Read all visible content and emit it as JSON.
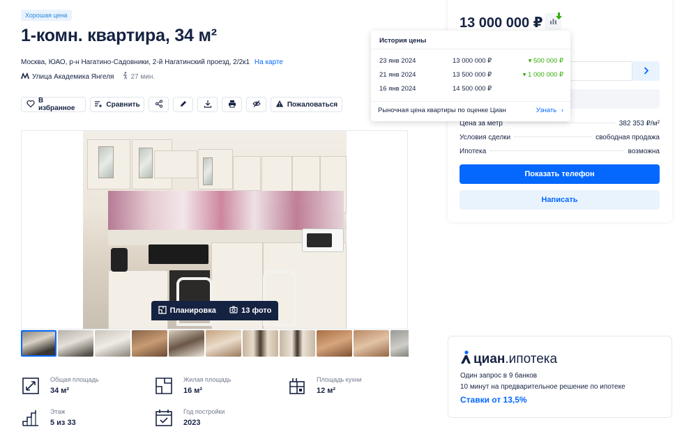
{
  "badge": "Хорошая цена",
  "title": "1-комн. квартира, 34 м²",
  "address": {
    "text": "Москва, ЮАО, р-н Нагатино-Садовники, 2-й Нагатинский проезд, 2/2к1",
    "map_link": "На карте"
  },
  "metro": {
    "icon": "metro-icon",
    "station": "Улица Академика Янгеля",
    "walk": "27 мин."
  },
  "actions": {
    "favorite": "В избранное",
    "compare": "Сравнить",
    "report": "Пожаловаться"
  },
  "gallery": {
    "layout_label": "Планировка",
    "photos_label": "13 фото"
  },
  "features": [
    {
      "icon": "total-area-icon",
      "label": "Общая площадь",
      "value": "34 м²"
    },
    {
      "icon": "living-area-icon",
      "label": "Жилая площадь",
      "value": "16 м²"
    },
    {
      "icon": "kitchen-area-icon",
      "label": "Площадь кухни",
      "value": "12 м²"
    },
    {
      "icon": "floor-icon",
      "label": "Этаж",
      "value": "5 из 33"
    },
    {
      "icon": "build-year-icon",
      "label": "Год постройки",
      "value": "2023"
    }
  ],
  "price_card": {
    "price": "13 000 000 ₽",
    "details": [
      {
        "key": "Цена за метр",
        "value": "382 353 ₽/м²"
      },
      {
        "key": "Условия сделки",
        "value": "свободная продажа"
      },
      {
        "key": "Ипотека",
        "value": "возможна"
      }
    ],
    "show_phone": "Показать телефон",
    "write": "Написать"
  },
  "price_history": {
    "title": "История цены",
    "rows": [
      {
        "date": "23 янв 2024",
        "price": "13 000 000 ₽",
        "change": "▾ 500 000 ₽"
      },
      {
        "date": "21 янв 2024",
        "price": "13 500 000 ₽",
        "change": "▾ 1 000 000 ₽"
      },
      {
        "date": "16 янв 2024",
        "price": "14 500 000 ₽",
        "change": ""
      }
    ],
    "market_text": "Рыночная цена квартиры по оценке Циан",
    "market_link": "Узнать"
  },
  "mortgage": {
    "logo_bold": "циан",
    "logo_rest": ".ипотека",
    "line1": "Один запрос в 9 банков",
    "line2": "10 минут на предварительное решение по ипотеке",
    "rates": "Ставки от 13,5%"
  },
  "colors": {
    "accent": "#0468ff",
    "text": "#152242",
    "price_down": "#34ac0a",
    "badge_bg": "#e8f3fe"
  }
}
